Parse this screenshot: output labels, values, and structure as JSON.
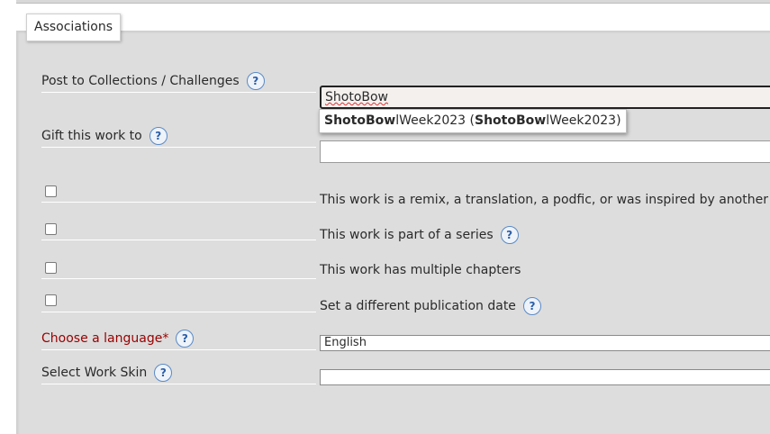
{
  "section": {
    "legend": "Associations"
  },
  "collections": {
    "label": "Post to Collections / Challenges",
    "input_value": "ShotoBow",
    "suggestion": {
      "match1": "ShotoBow",
      "rest1": "lWeek2023 (",
      "match2": "ShotoBow",
      "rest2": "lWeek2023)"
    }
  },
  "gift": {
    "label": "Gift this work to",
    "input_value": ""
  },
  "options": {
    "remix": "This work is a remix, a translation, a podfic, or was inspired by another w",
    "series": "This work is part of a series",
    "chapters": "This work has multiple chapters",
    "pubdate": "Set a different publication date"
  },
  "language": {
    "label": "Choose a language*",
    "selected": "English"
  },
  "workskin": {
    "label": "Select Work Skin",
    "selected": ""
  },
  "help_glyph": "?"
}
